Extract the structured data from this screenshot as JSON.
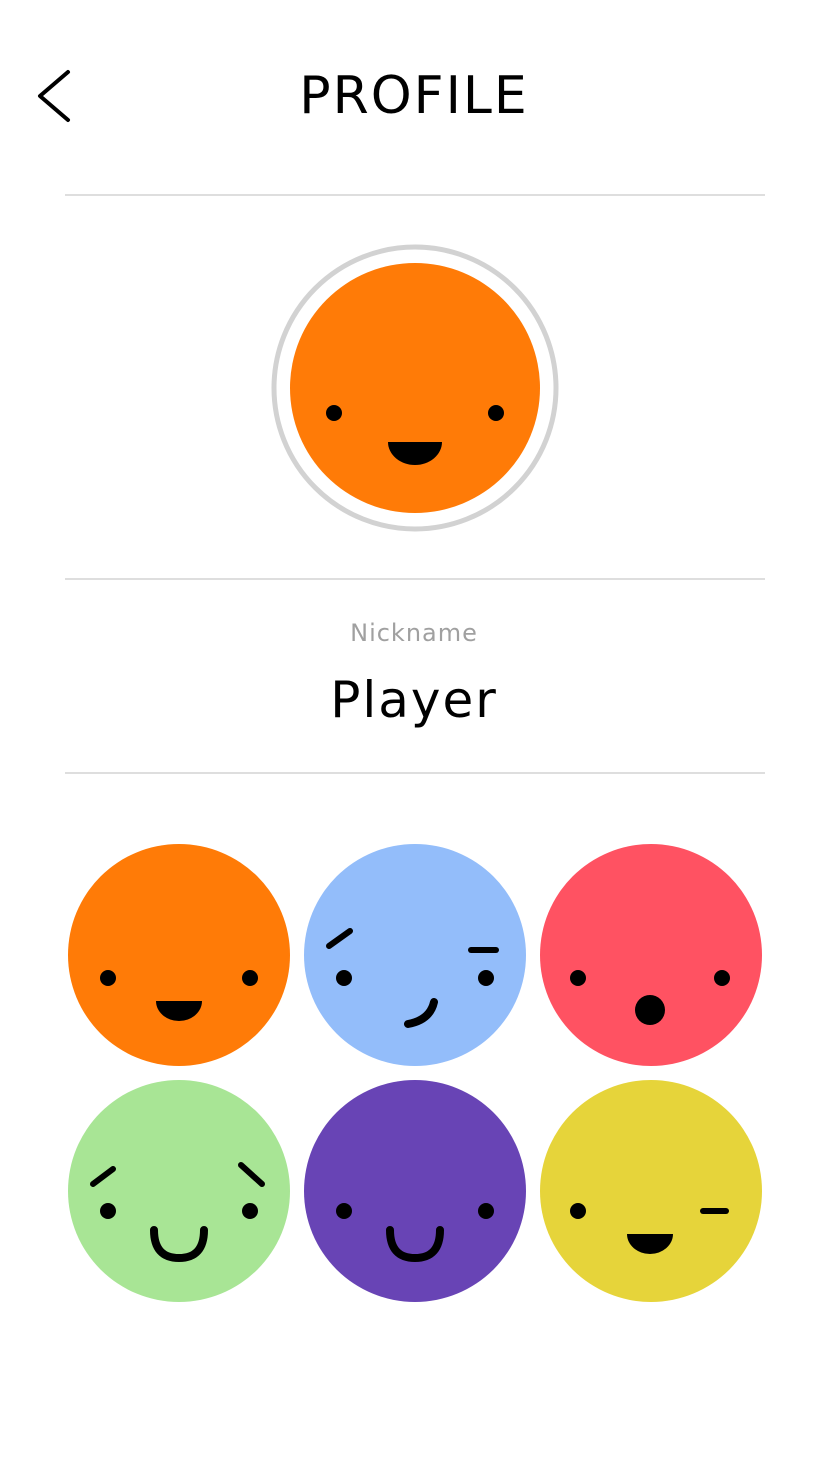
{
  "header": {
    "title": "PROFILE",
    "back_icon": "chevron-left-icon"
  },
  "profile": {
    "avatar": {
      "color": "#FF7B07",
      "ring_color": "#D2D2D2",
      "expression": "smile"
    },
    "nickname_label": "Nickname",
    "nickname_value": "Player"
  },
  "avatar_options": [
    {
      "color": "#FF7B07",
      "expression": "smile"
    },
    {
      "color": "#93BDFA",
      "expression": "smirk"
    },
    {
      "color": "#FF5262",
      "expression": "surprised"
    },
    {
      "color": "#A8E595",
      "expression": "happy-brows"
    },
    {
      "color": "#6844B5",
      "expression": "grin"
    },
    {
      "color": "#E6D43A",
      "expression": "wink"
    }
  ],
  "colors": {
    "divider": "#DEDEDE",
    "label_gray": "#A0A0A0",
    "text": "#000000"
  }
}
